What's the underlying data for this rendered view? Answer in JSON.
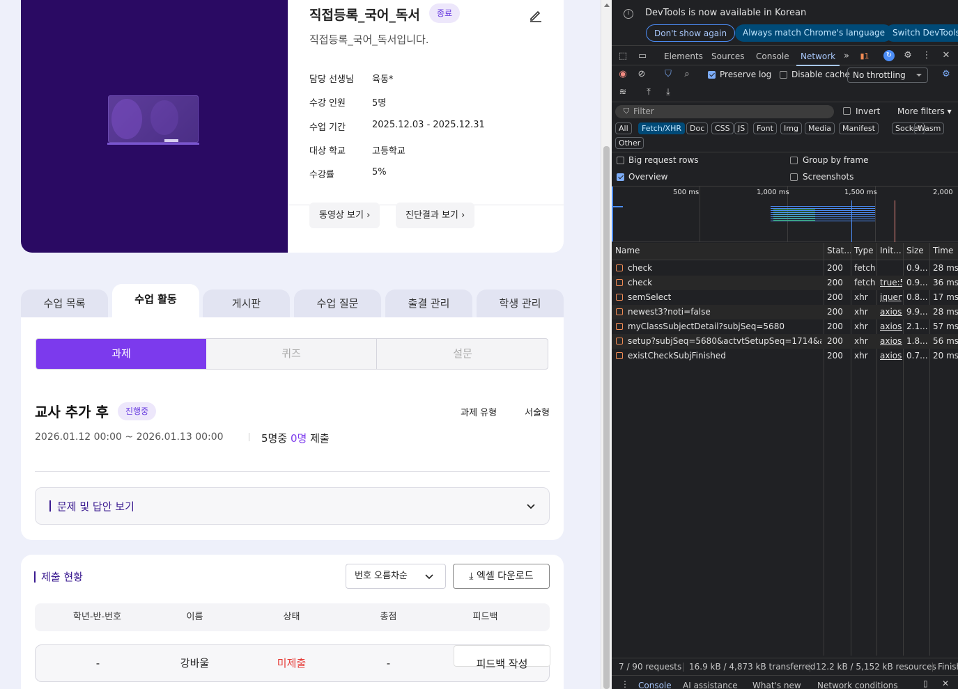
{
  "course": {
    "title": "직접등록_국어_독서",
    "status": "종료",
    "description": "직접등록_국어_독서입니다.",
    "details": [
      {
        "label": "담당 선생님",
        "value": "육동*"
      },
      {
        "label": "수강 인원",
        "value": "5명"
      },
      {
        "label": "수업 기간",
        "value": "2025.12.03 - 2025.12.31"
      },
      {
        "label": "대상 학교",
        "value": "고등학교"
      },
      {
        "label": "수강률",
        "value": "5%"
      }
    ],
    "buttons": {
      "video": "동영상 보기",
      "diagnosis": "진단결과 보기"
    }
  },
  "tabs": [
    "수업 목록",
    "수업 활동",
    "게시판",
    "수업 질문",
    "출결 관리",
    "학생 관리"
  ],
  "active_tab": "수업 활동",
  "segments": [
    "과제",
    "퀴즈",
    "설문"
  ],
  "assignment": {
    "title": "교사 추가 후",
    "status": "진행중",
    "type_label": "과제 유형",
    "type_value": "서술형",
    "date_range": "2026.01.12 00:00 ~ 2026.01.13 00:00",
    "submit_prefix": "5명중",
    "submit_count": "0명",
    "submit_suffix": "제출",
    "accordion_label": "문제 및 답안 보기"
  },
  "submission": {
    "title": "제출 현황",
    "sort_label": "번호 오름차순",
    "excel_label": "엑셀 다운로드",
    "columns": [
      "학년-반-번호",
      "이름",
      "상태",
      "총점",
      "피드백"
    ],
    "rows": [
      {
        "number": "-",
        "name": "강바울",
        "status": "미제출",
        "score": "-",
        "feedback": "피드백 작성"
      }
    ]
  },
  "devtools": {
    "notice": "DevTools is now available in Korean",
    "notice_buttons": [
      "Don't show again",
      "Always match Chrome's language",
      "Switch DevTools"
    ],
    "tabs": [
      "Elements",
      "Sources",
      "Console",
      "Network"
    ],
    "active_tab": "Network",
    "issues_count": "1",
    "preserve_log": "Preserve log",
    "disable_cache": "Disable cache",
    "throttling": "No throttling",
    "filter_placeholder": "Filter",
    "invert": "Invert",
    "more_filters": "More filters",
    "type_filters": [
      "All",
      "Fetch/XHR",
      "Doc",
      "CSS",
      "JS",
      "Font",
      "Img",
      "Media",
      "Manifest",
      "Socket",
      "Wasm",
      "Other"
    ],
    "active_filter": "Fetch/XHR",
    "options": {
      "big_rows": "Big request rows",
      "group_frame": "Group by frame",
      "overview": "Overview",
      "screenshots": "Screenshots"
    },
    "timeline_ticks": [
      "500 ms",
      "1,000 ms",
      "1,500 ms",
      "2,000"
    ],
    "columns": [
      "Name",
      "Stat...",
      "Type",
      "Init...",
      "Size",
      "Time"
    ],
    "requests": [
      {
        "name": "check",
        "status": "200",
        "type": "fetch",
        "initiator": "",
        "size": "0.9...",
        "time": "28 ms"
      },
      {
        "name": "check",
        "status": "200",
        "type": "fetch",
        "initiator": "true:5",
        "size": "0.9...",
        "time": "36 ms"
      },
      {
        "name": "semSelect",
        "status": "200",
        "type": "xhr",
        "initiator": "jquery",
        "size": "0.8...",
        "time": "17 ms"
      },
      {
        "name": "newest3?noti=false",
        "status": "200",
        "type": "xhr",
        "initiator": "axios.r",
        "size": "9.9...",
        "time": "28 ms"
      },
      {
        "name": "myClassSubjectDetail?subjSeq=5680",
        "status": "200",
        "type": "xhr",
        "initiator": "axios.r",
        "size": "2.1...",
        "time": "57 ms"
      },
      {
        "name": "setup?subjSeq=5680&actvtSetupSeq=1714&actv...",
        "status": "200",
        "type": "xhr",
        "initiator": "axios.r",
        "size": "1.8...",
        "time": "56 ms"
      },
      {
        "name": "existCheckSubjFinished",
        "status": "200",
        "type": "xhr",
        "initiator": "axios.r",
        "size": "0.7...",
        "time": "20 ms"
      }
    ],
    "status_bar": [
      "7 / 90 requests",
      "16.9 kB / 4,873 kB transferred",
      "12.2 kB / 5,152 kB resources",
      "Finish"
    ],
    "drawer_tabs": [
      "Console",
      "AI assistance",
      "What's new",
      "Network conditions"
    ],
    "colors": {
      "bg": "#202124",
      "accent": "#a8c7fa"
    }
  }
}
